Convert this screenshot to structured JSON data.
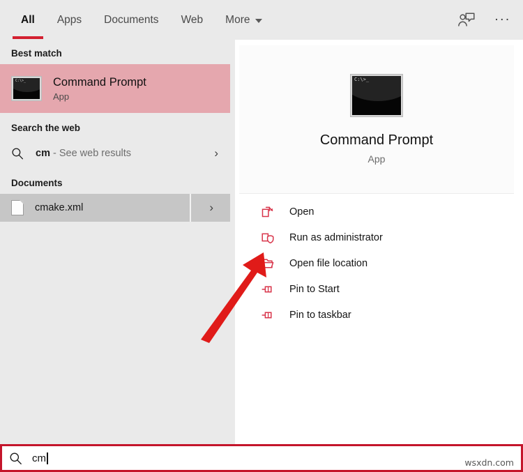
{
  "tabs": [
    {
      "label": "All",
      "active": true
    },
    {
      "label": "Apps",
      "active": false
    },
    {
      "label": "Documents",
      "active": false
    },
    {
      "label": "Web",
      "active": false
    },
    {
      "label": "More",
      "active": false,
      "has_caret": true
    }
  ],
  "tabbar_right": {
    "feedback_icon": "feedback-person-icon",
    "overflow_label": "..."
  },
  "left_pane": {
    "best_match": {
      "header": "Best match",
      "title": "Command Prompt",
      "subtitle": "App",
      "icon": "command-prompt-icon",
      "prompt_text": "C:\\>_",
      "highlight_color": "#e5a7ae"
    },
    "web": {
      "header": "Search the web",
      "icon": "search-icon",
      "query": "cm",
      "suffix": " - See web results",
      "chevron": "›"
    },
    "documents": {
      "header": "Documents",
      "icon": "file-icon",
      "name": "cmake.xml",
      "chevron": "›"
    }
  },
  "right_pane": {
    "preview": {
      "title": "Command Prompt",
      "subtitle": "App",
      "icon": "command-prompt-icon",
      "prompt_text": "C:\\>_"
    },
    "actions": [
      {
        "label": "Open",
        "icon": "open-in-new-icon"
      },
      {
        "label": "Run as administrator",
        "icon": "shield-icon"
      },
      {
        "label": "Open file location",
        "icon": "folder-icon"
      },
      {
        "label": "Pin to Start",
        "icon": "pin-icon"
      },
      {
        "label": "Pin to taskbar",
        "icon": "pin-icon"
      }
    ],
    "action_icon_color": "#d8344a"
  },
  "annotation": {
    "arrow_color": "#e01b19",
    "points_to": "Run as administrator"
  },
  "search_bar": {
    "icon": "search-icon",
    "value": "cm",
    "border_color": "#c4152b"
  },
  "watermark": "wsxdn.com"
}
